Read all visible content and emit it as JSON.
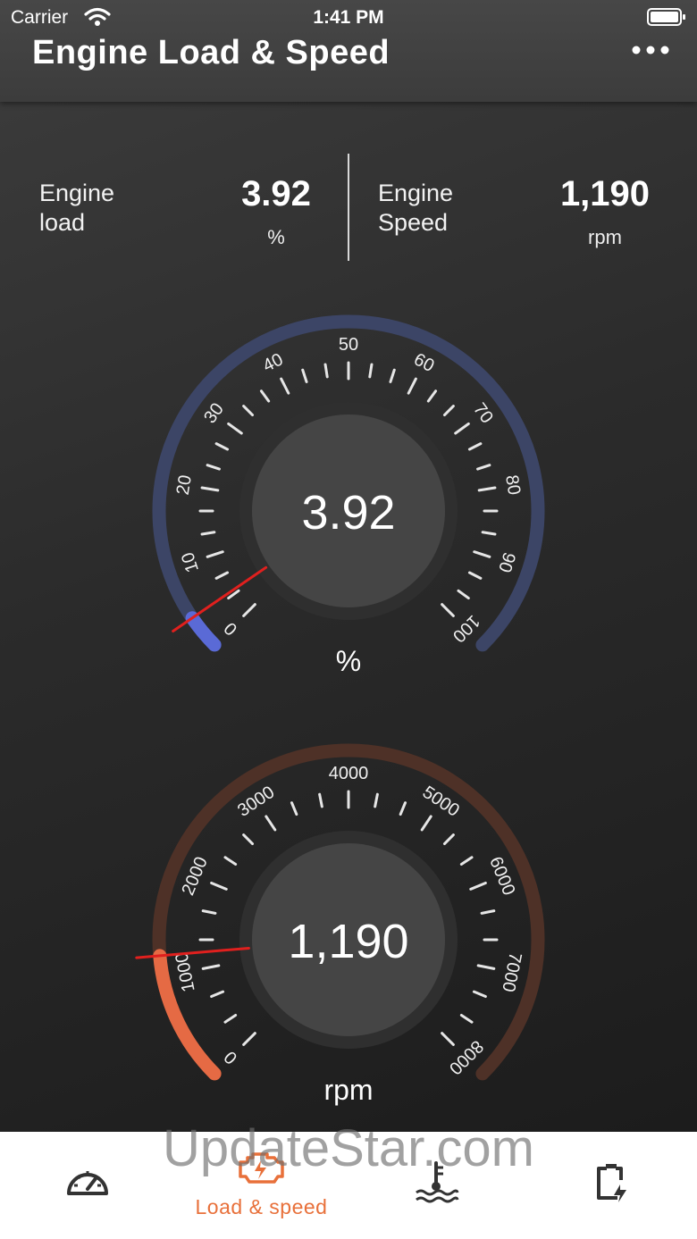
{
  "status_bar": {
    "carrier": "Carrier",
    "time": "1:41 PM"
  },
  "header": {
    "title": "Engine Load & Speed"
  },
  "readouts": {
    "load": {
      "label_line1": "Engine",
      "label_line2": "load",
      "value": "3.92",
      "unit": "%"
    },
    "speed": {
      "label_line1": "Engine",
      "label_line2": "Speed",
      "value": "1,190",
      "unit": "rpm"
    }
  },
  "load_gauge": {
    "value_text": "3.92",
    "unit": "%",
    "value": 3.92,
    "min": 0,
    "max": 100,
    "ticks": [
      "0",
      "10",
      "20",
      "30",
      "40",
      "50",
      "60",
      "70",
      "80",
      "90",
      "100"
    ],
    "track_color": "#3c4566",
    "fill_color": "#5a6ad6"
  },
  "rpm_gauge": {
    "value_text": "1,190",
    "unit": "rpm",
    "value": 1190,
    "min": 0,
    "max": 8000,
    "ticks": [
      "0",
      "1000",
      "2000",
      "3000",
      "4000",
      "5000",
      "6000",
      "7000",
      "8000"
    ],
    "track_color": "#4e3127",
    "fill_color": "#e56a44"
  },
  "tabs": [
    {
      "icon": "speedometer-icon",
      "label": ""
    },
    {
      "icon": "engine-icon",
      "label": "Load & speed",
      "active": true
    },
    {
      "icon": "coolant-temperature-icon",
      "label": ""
    },
    {
      "icon": "battery-charge-icon",
      "label": ""
    }
  ],
  "colors": {
    "accent": "#e8703a",
    "needle": "#e0201e"
  },
  "watermark": "UpdateStar.com"
}
